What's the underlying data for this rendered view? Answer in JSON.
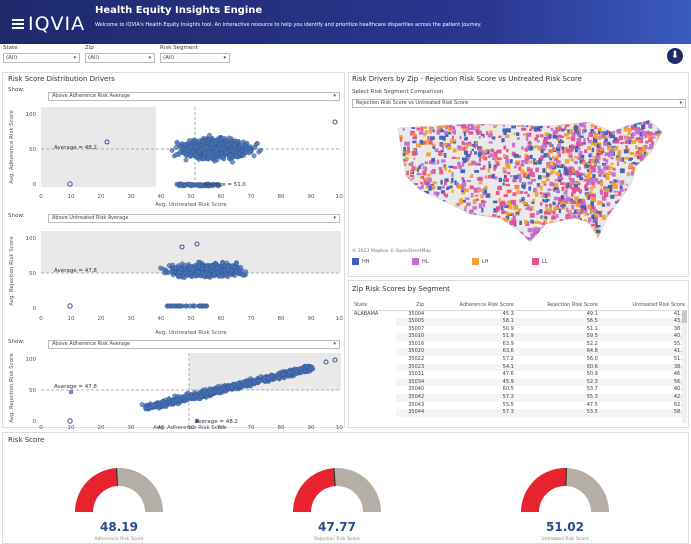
{
  "header": {
    "logo": "IQVIA",
    "title": "Health Equity Insights Engine",
    "subtitle": "Welcome to IQVIA's Health Equity Insights tool. An interactive resource to help you identify and prioritize healthcare disparities across the patient journey."
  },
  "filters": {
    "state_label": "State",
    "state_value": "(All)",
    "zip_label": "Zip",
    "zip_value": "(All)",
    "segment_label": "Risk Segment",
    "segment_value": "(All)"
  },
  "icons": {
    "download": "download-icon"
  },
  "drivers": {
    "title": "Risk Score Distribution Drivers",
    "show_label": "Show:",
    "plot1": {
      "dropdown": "Above Adherence Risk Average",
      "ylabel": "Avg. Adherence Risk Score",
      "xlabel": "Avg. Untreated Risk Score",
      "avg_y": "Average = 48.2",
      "avg_x": "Average = 51.0"
    },
    "plot2": {
      "dropdown": "Above Untreated Risk Average",
      "ylabel": "Avg. Rejection Risk Score",
      "xlabel": "Avg. Untreated Risk Score",
      "avg_y": "Average = 47.8"
    },
    "plot3": {
      "dropdown": "Above Adherence Risk Average",
      "ylabel": "Avg. Rejection Risk Score",
      "xlabel": "Avg. Adherence Risk Score",
      "avg_y": "Average = 47.8",
      "avg_x": "Average = 48.2"
    },
    "yticks": [
      "100",
      "50",
      "0"
    ],
    "xticks": [
      "0",
      "10",
      "20",
      "30",
      "40",
      "50",
      "60",
      "70",
      "80",
      "90",
      "100"
    ]
  },
  "map": {
    "title": "Risk Drivers by Zip - Rejection Risk Score vs Untreated Risk Score",
    "select_label": "Select Risk Segment Comparison",
    "select_value": "Rejection Risk Score vs Untreated Risk Score",
    "attribution": "© 2023 Mapbox  © OpenStreetMap",
    "legend": [
      {
        "label": "HH",
        "color": "#3f5fb5"
      },
      {
        "label": "HL",
        "color": "#c26fd1"
      },
      {
        "label": "LH",
        "color": "#f2a033"
      },
      {
        "label": "LL",
        "color": "#e8508f"
      }
    ]
  },
  "table": {
    "title": "Zip Risk Scores by Segment",
    "columns": [
      "State",
      "Zip",
      "Adherence Risk Score",
      "Rejection Risk Score",
      "Untreated Risk Score"
    ],
    "state": "ALABAMA",
    "rows": [
      [
        "35004",
        "45.3",
        "49.1",
        "41.9"
      ],
      [
        "35005",
        "58.1",
        "56.5",
        "43.8"
      ],
      [
        "35007",
        "50.9",
        "51.1",
        "38.3"
      ],
      [
        "35010",
        "51.9",
        "59.5",
        "40.3"
      ],
      [
        "35016",
        "63.9",
        "52.2",
        "55.1"
      ],
      [
        "35020",
        "63.6",
        "64.8",
        "41.5"
      ],
      [
        "35022",
        "57.2",
        "56.0",
        "51.6"
      ],
      [
        "35023",
        "54.1",
        "60.6",
        "38.1"
      ],
      [
        "35031",
        "47.6",
        "50.9",
        "46.8"
      ],
      [
        "35034",
        "45.9",
        "52.3",
        "56.8"
      ],
      [
        "35040",
        "60.5",
        "53.7",
        "40.3"
      ],
      [
        "35042",
        "57.3",
        "55.3",
        "42.5"
      ],
      [
        "35043",
        "55.5",
        "47.5",
        "62.7"
      ],
      [
        "35044",
        "57.3",
        "53.5",
        "58.1"
      ]
    ]
  },
  "risk": {
    "title": "Risk Score",
    "gauges": [
      {
        "value": "48.19",
        "fraction": 0.4819,
        "label": "Adherence Risk Score"
      },
      {
        "value": "47.77",
        "fraction": 0.4777,
        "label": "Rejection Risk Score"
      },
      {
        "value": "51.02",
        "fraction": 0.5102,
        "label": "Untreated Risk Score"
      }
    ]
  }
}
